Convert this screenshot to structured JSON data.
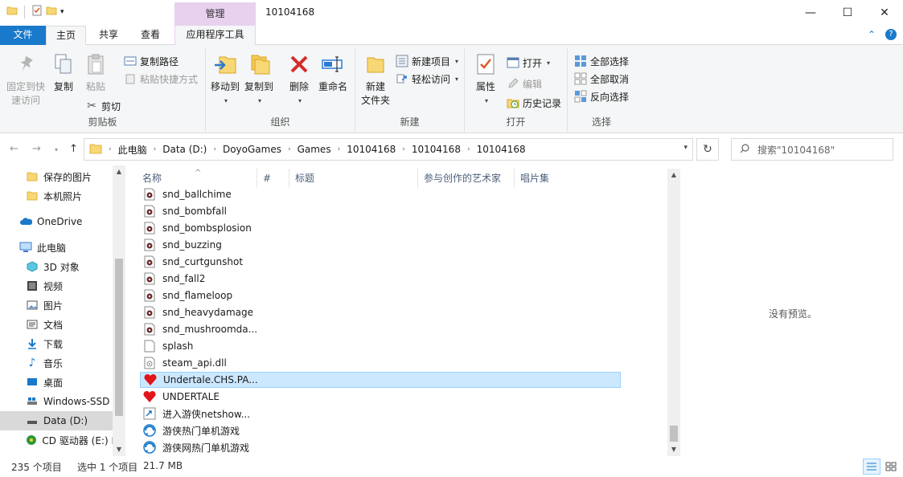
{
  "window": {
    "context_tab_header": "管理",
    "title": "10104168"
  },
  "tabs": {
    "file": "文件",
    "home": "主页",
    "share": "共享",
    "view": "查看",
    "app_tools": "应用程序工具"
  },
  "ribbon": {
    "clipboard": {
      "label": "剪贴板",
      "pin_line1": "固定到快",
      "pin_line2": "速访问",
      "copy": "复制",
      "paste": "粘贴",
      "copy_path": "复制路径",
      "paste_shortcut": "粘贴快捷方式",
      "cut": "剪切"
    },
    "organize": {
      "label": "组织",
      "move_to": "移动到",
      "copy_to": "复制到",
      "delete": "删除",
      "rename": "重命名"
    },
    "new": {
      "label": "新建",
      "new_folder_line1": "新建",
      "new_folder_line2": "文件夹",
      "new_item": "新建项目",
      "easy_access": "轻松访问"
    },
    "open": {
      "label": "打开",
      "properties": "属性",
      "open": "打开",
      "edit": "编辑",
      "history": "历史记录"
    },
    "select": {
      "label": "选择",
      "select_all": "全部选择",
      "select_none": "全部取消",
      "invert": "反向选择"
    }
  },
  "address": {
    "crumbs": [
      "此电脑",
      "Data (D:)",
      "DoyoGames",
      "Games",
      "10104168",
      "10104168",
      "10104168"
    ]
  },
  "search": {
    "placeholder": "搜索\"10104168\""
  },
  "nav": {
    "items": [
      {
        "label": "保存的图片",
        "icon": "folder-icon"
      },
      {
        "label": "本机照片",
        "icon": "folder-icon"
      },
      {
        "label": "OneDrive",
        "icon": "cloud-icon"
      },
      {
        "label": "此电脑",
        "icon": "computer-icon"
      },
      {
        "label": "3D 对象",
        "icon": "cube-icon"
      },
      {
        "label": "视频",
        "icon": "video-icon"
      },
      {
        "label": "图片",
        "icon": "picture-icon"
      },
      {
        "label": "文档",
        "icon": "document-icon"
      },
      {
        "label": "下载",
        "icon": "download-icon"
      },
      {
        "label": "音乐",
        "icon": "music-icon"
      },
      {
        "label": "桌面",
        "icon": "desktop-icon"
      },
      {
        "label": "Windows-SSD",
        "icon": "drive-icon"
      },
      {
        "label": "Data (D:)",
        "icon": "drive-icon"
      },
      {
        "label": "CD 驱动器 (E:) I",
        "icon": "cd-drive-icon"
      }
    ]
  },
  "columns": {
    "name": "名称",
    "number": "#",
    "title": "标题",
    "artists": "参与创作的艺术家",
    "album": "唱片集"
  },
  "files": [
    {
      "name": "snd_ballchime",
      "icon": "audio-file-icon"
    },
    {
      "name": "snd_bombfall",
      "icon": "audio-file-icon"
    },
    {
      "name": "snd_bombsplosion",
      "icon": "audio-file-icon"
    },
    {
      "name": "snd_buzzing",
      "icon": "audio-file-icon"
    },
    {
      "name": "snd_curtgunshot",
      "icon": "audio-file-icon"
    },
    {
      "name": "snd_fall2",
      "icon": "audio-file-icon"
    },
    {
      "name": "snd_flameloop",
      "icon": "audio-file-icon"
    },
    {
      "name": "snd_heavydamage",
      "icon": "audio-file-icon"
    },
    {
      "name": "snd_mushroomda...",
      "icon": "audio-file-icon"
    },
    {
      "name": "splash",
      "icon": "blank-file-icon"
    },
    {
      "name": "steam_api.dll",
      "icon": "dll-file-icon"
    },
    {
      "name": "Undertale.CHS.PA...",
      "icon": "heart-app-icon"
    },
    {
      "name": "UNDERTALE",
      "icon": "heart-app-icon"
    },
    {
      "name": "进入游侠netshow...",
      "icon": "shortcut-icon"
    },
    {
      "name": "游侠热门单机游戏",
      "icon": "web-shortcut-icon"
    },
    {
      "name": "游侠网热门单机游戏",
      "icon": "web-shortcut-icon"
    }
  ],
  "preview": {
    "empty_text": "没有预览。"
  },
  "status": {
    "item_count": "235 个项目",
    "selected": "选中 1 个项目",
    "size": "21.7 MB"
  },
  "colors": {
    "accent": "#1979ca",
    "context_tab": "#e8d0ef",
    "selection": "#cce8ff",
    "selection_border": "#99d1ff"
  }
}
